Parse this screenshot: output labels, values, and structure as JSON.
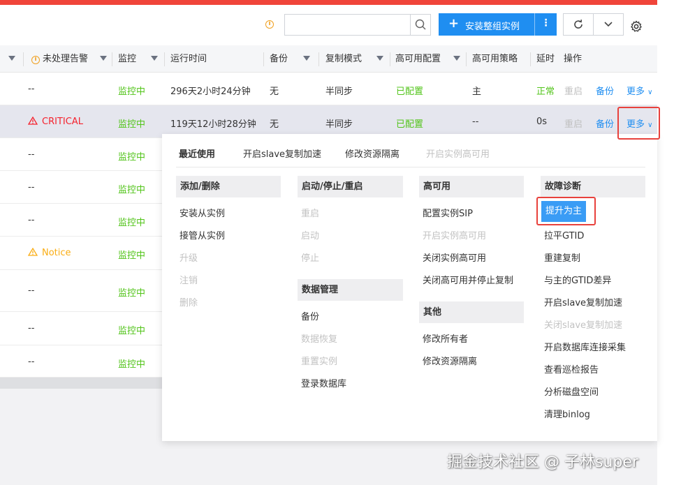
{
  "toolbar": {
    "search_placeholder": "",
    "install_label": "安装整组实例",
    "install_more": "⋮",
    "refresh_icon": "refresh-icon",
    "chevron_icon": "chevron-down-icon",
    "settings_icon": "gear-icon"
  },
  "table": {
    "headers": {
      "alert": "未处理告警",
      "monitor": "监控",
      "uptime": "运行时间",
      "backup": "备份",
      "repl_mode": "复制模式",
      "ha_config": "高可用配置",
      "ha_policy": "高可用策略",
      "delay": "延时",
      "actions": "操作"
    },
    "rows": [
      {
        "alert": "--",
        "alert_level": "",
        "monitor": "监控中",
        "uptime": "296天2小时24分钟",
        "backup": "无",
        "repl_mode": "半同步",
        "ha_config": "已配置",
        "ha_policy": "主",
        "delay": "正常",
        "restart": "重启",
        "backup_btn": "备份",
        "more": "更多"
      },
      {
        "alert": "CRITICAL",
        "alert_level": "critical",
        "monitor": "监控中",
        "uptime": "119天12小时28分钟",
        "backup": "无",
        "repl_mode": "半同步",
        "ha_config": "已配置",
        "ha_policy": "--",
        "delay": "0s",
        "restart": "重启",
        "backup_btn": "备份",
        "more": "更多"
      },
      {
        "alert": "--",
        "monitor": "监控中"
      },
      {
        "alert": "--",
        "monitor": "监控中"
      },
      {
        "alert": "--",
        "monitor": "监控中"
      },
      {
        "alert": "Notice",
        "alert_level": "notice",
        "monitor": "监控中"
      },
      {
        "alert": "--",
        "monitor": "监控中"
      },
      {
        "alert": "--",
        "monitor": "监控中"
      },
      {
        "alert": "--",
        "monitor": "监控中"
      }
    ]
  },
  "dropdown": {
    "recent_label": "最近使用",
    "recent_items": [
      "开启slave复制加速",
      "修改资源隔离",
      "开启实例高可用"
    ],
    "groups": {
      "add_remove": {
        "title": "添加/删除",
        "items": [
          "安装从实例",
          "接管从实例",
          "升级",
          "注销",
          "删除"
        ]
      },
      "start_stop": {
        "title": "启动/停止/重启",
        "items": [
          "重启",
          "启动",
          "停止"
        ]
      },
      "data_mgmt": {
        "title": "数据管理",
        "items": [
          "备份",
          "数据恢复",
          "重置实例",
          "登录数据库"
        ]
      },
      "ha": {
        "title": "高可用",
        "items": [
          "配置实例SIP",
          "开启实例高可用",
          "关闭实例高可用",
          "关闭高可用并停止复制"
        ]
      },
      "other": {
        "title": "其他",
        "items": [
          "修改所有者",
          "修改资源隔离"
        ]
      },
      "diagnose": {
        "title": "故障诊断",
        "items": [
          "提升为主",
          "拉平GTID",
          "重建复制",
          "与主的GTID差异",
          "开启slave复制加速",
          "关闭slave复制加速",
          "开启数据库连接采集",
          "查看巡检报告",
          "分析磁盘空间",
          "清理binlog"
        ]
      }
    }
  },
  "watermark": "掘金技术社区 @ 子林super"
}
